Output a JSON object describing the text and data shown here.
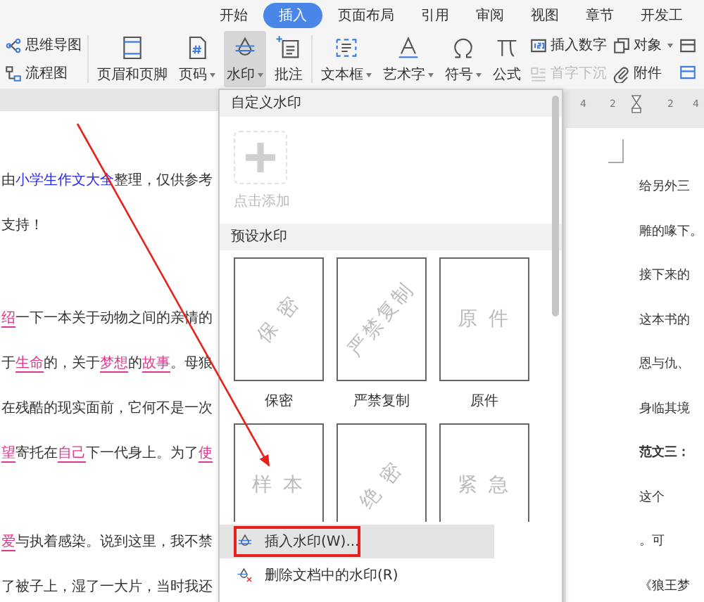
{
  "tabs": [
    {
      "label": "开始",
      "selected": false
    },
    {
      "label": "插入",
      "selected": true
    },
    {
      "label": "页面布局",
      "selected": false
    },
    {
      "label": "引用",
      "selected": false
    },
    {
      "label": "审阅",
      "selected": false
    },
    {
      "label": "视图",
      "selected": false
    },
    {
      "label": "章节",
      "selected": false
    },
    {
      "label": "开发工",
      "selected": false
    }
  ],
  "ribbon": [
    {
      "kind": "stack",
      "items": [
        {
          "label": "思维导图",
          "dropdown": false,
          "disabled": false
        },
        {
          "label": "流程图",
          "dropdown": false,
          "disabled": false
        }
      ]
    },
    {
      "kind": "large",
      "label": "页眉和页脚",
      "dropdown": false,
      "selected": false
    },
    {
      "kind": "large",
      "label": "页码",
      "dropdown": true,
      "selected": false
    },
    {
      "kind": "large",
      "label": "水印",
      "dropdown": true,
      "selected": true
    },
    {
      "kind": "large",
      "label": "批注",
      "dropdown": false,
      "selected": false
    },
    {
      "kind": "large",
      "label": "文本框",
      "dropdown": true,
      "selected": false
    },
    {
      "kind": "large",
      "label": "艺术字",
      "dropdown": true,
      "selected": false
    },
    {
      "kind": "large",
      "label": "符号",
      "dropdown": true,
      "selected": false
    },
    {
      "kind": "large",
      "label": "公式",
      "dropdown": false,
      "selected": false
    },
    {
      "kind": "stack",
      "items": [
        {
          "label": "插入数字",
          "dropdown": false,
          "disabled": false
        },
        {
          "label": "首字下沉",
          "dropdown": false,
          "disabled": true
        }
      ]
    },
    {
      "kind": "stack",
      "items": [
        {
          "label": "对象",
          "dropdown": true,
          "disabled": false
        },
        {
          "label": "附件",
          "dropdown": false,
          "disabled": false
        }
      ]
    }
  ],
  "left_document": {
    "lines": [
      [
        {
          "text": "由",
          "kind": "plain"
        },
        {
          "text": "小学生作文大全",
          "kind": "link"
        },
        {
          "text": "整理，仅供参考",
          "kind": "plain"
        }
      ],
      [
        {
          "text": "支持！",
          "kind": "plain"
        }
      ],
      [
        {
          "text": "绍",
          "kind": "keyword"
        },
        {
          "text": "一下一本关于动物之间的亲情的",
          "kind": "plain"
        }
      ],
      [
        {
          "text": "于",
          "kind": "plain"
        },
        {
          "text": "生命",
          "kind": "keyword"
        },
        {
          "text": "的，关于",
          "kind": "plain"
        },
        {
          "text": "梦想",
          "kind": "keyword"
        },
        {
          "text": "的",
          "kind": "plain"
        },
        {
          "text": "故事",
          "kind": "keyword"
        },
        {
          "text": "。母狼",
          "kind": "plain"
        }
      ],
      [
        {
          "text": "在残酷的现实面前，它何不是一次",
          "kind": "plain"
        }
      ],
      [
        {
          "text": "望",
          "kind": "keyword"
        },
        {
          "text": "寄托在",
          "kind": "plain"
        },
        {
          "text": "自己",
          "kind": "keyword"
        },
        {
          "text": "下一代身上。为了",
          "kind": "plain"
        },
        {
          "text": "使",
          "kind": "keyword"
        }
      ],
      [
        {
          "text": "爱",
          "kind": "keyword"
        },
        {
          "text": "与执着感染。说到这里，我不禁",
          "kind": "plain"
        }
      ],
      [
        {
          "text": "了被子上，湿了一大片，当时我还",
          "kind": "plain"
        }
      ]
    ]
  },
  "watermark_menu": {
    "custom_header": "自定义水印",
    "add_label": "点击添加",
    "preset_header": "预设水印",
    "presets": [
      {
        "text": "保 密",
        "label": "保密",
        "kind": "diagonal"
      },
      {
        "text": "严禁复制",
        "label": "严禁复制",
        "kind": "diagonal"
      },
      {
        "text": "原 件",
        "label": "原件",
        "kind": "horizontal"
      },
      {
        "text": "样 本",
        "kind": "horizontal"
      },
      {
        "text": "绝 密",
        "kind": "diagonal"
      },
      {
        "text": "紧 急",
        "kind": "horizontal"
      }
    ],
    "items": [
      {
        "label": "插入水印(W)...",
        "selected": true,
        "annotated": true
      },
      {
        "label": "删除文档中的水印(R)",
        "selected": false,
        "annotated": false
      }
    ]
  },
  "right_document": {
    "ruler_labels": [
      "4",
      "2",
      "2",
      "4"
    ],
    "lines": [
      {
        "text": "给另外三",
        "bold": false
      },
      {
        "text": "雕的喙下。",
        "bold": false
      },
      {
        "text": "接下来的",
        "bold": false
      },
      {
        "text": "这本书的",
        "bold": false
      },
      {
        "text": "恩与仇、",
        "bold": false
      },
      {
        "text": "身临其境",
        "bold": false
      },
      {
        "text": "范文三：",
        "bold": true
      },
      {
        "text": "这个",
        "bold": false
      },
      {
        "text": "。可",
        "bold": false
      },
      {
        "text": "《狼王梦",
        "bold": false
      }
    ]
  }
}
